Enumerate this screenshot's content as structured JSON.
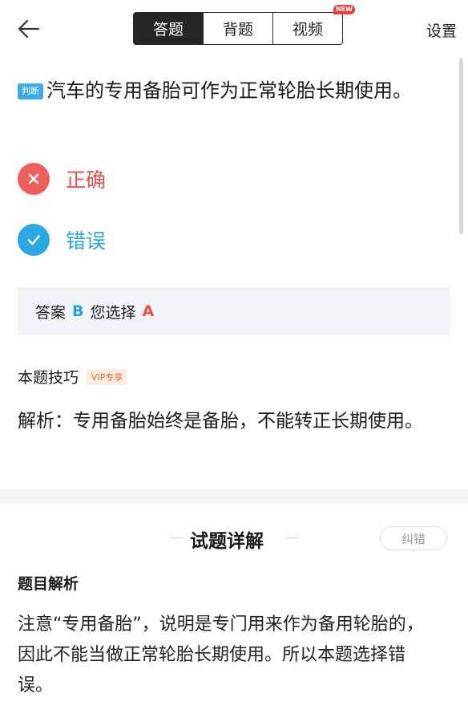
{
  "header": {
    "tabs": [
      {
        "label": "答题",
        "active": true
      },
      {
        "label": "背题",
        "active": false
      },
      {
        "label": "视频",
        "active": false,
        "badge": "NEW"
      }
    ],
    "settings_label": "设置"
  },
  "question": {
    "type_tag": "判断",
    "text": "汽车的专用备胎可作为正常轮胎长期使用。"
  },
  "options": [
    {
      "label": "正确",
      "state": "wrong",
      "icon": "close-icon",
      "color": "#e85a55"
    },
    {
      "label": "错误",
      "state": "correct",
      "icon": "check-icon",
      "color": "#2aa6e0"
    }
  ],
  "answer": {
    "prefix": "答案",
    "correct": "B",
    "middle": "您选择",
    "selected": "A"
  },
  "tips": {
    "title": "本题技巧",
    "vip_badge": "VIP专享",
    "analysis": "解析：专用备胎始终是备胎，不能转正长期使用。"
  },
  "detail": {
    "title": "试题详解",
    "report_button": "纠错",
    "subtitle": "题目解析",
    "body": "注意“专用备胎”，说明是专门用来作为备用轮胎的，因此不能当做正常轮胎长期使用。所以本题选择错误。"
  }
}
